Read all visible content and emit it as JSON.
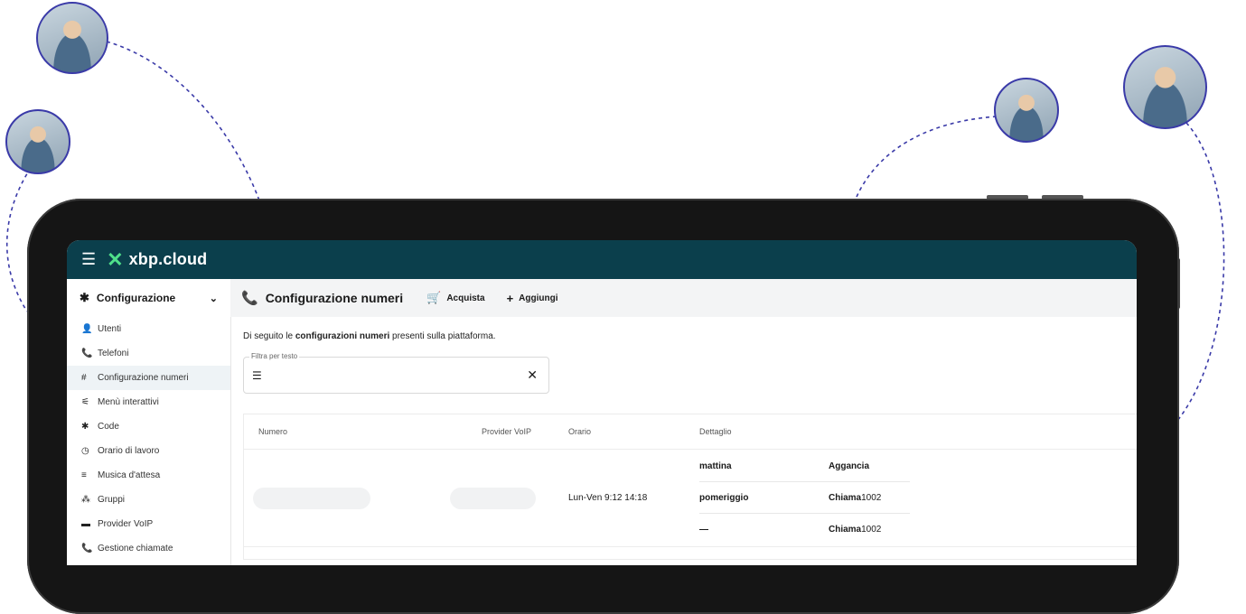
{
  "app": {
    "brand": "xbp.cloud"
  },
  "sidebar": {
    "section": "Configurazione",
    "items": [
      {
        "label": "Utenti",
        "icon": "person-icon",
        "glyph": "👤",
        "active": false
      },
      {
        "label": "Telefoni",
        "icon": "phone-icon",
        "glyph": "📞",
        "active": false
      },
      {
        "label": "Configurazione numeri",
        "icon": "hash-icon",
        "glyph": "#",
        "active": true
      },
      {
        "label": "Menù interattivi",
        "icon": "tree-icon",
        "glyph": "⚟",
        "active": false
      },
      {
        "label": "Code",
        "icon": "gear-icon",
        "glyph": "✱",
        "active": false
      },
      {
        "label": "Orario di lavoro",
        "icon": "clock-icon",
        "glyph": "◷",
        "active": false
      },
      {
        "label": "Musica d'attesa",
        "icon": "playlist-icon",
        "glyph": "≡",
        "active": false
      },
      {
        "label": "Gruppi",
        "icon": "group-icon",
        "glyph": "⁂",
        "active": false
      },
      {
        "label": "Provider VoIP",
        "icon": "card-icon",
        "glyph": "▬",
        "active": false
      },
      {
        "label": "Gestione chiamate",
        "icon": "phone-icon",
        "glyph": "📞",
        "active": false
      }
    ]
  },
  "toolbar": {
    "title": "Configurazione numeri",
    "buy_label": "Acquista",
    "add_label": "Aggiungi"
  },
  "intro": {
    "before": "Di seguito le ",
    "bold": "configurazioni numeri",
    "after": " presenti sulla piattaforma."
  },
  "filter": {
    "label": "Filtra per testo",
    "value": ""
  },
  "table": {
    "headers": {
      "numero": "Numero",
      "provider": "Provider VoIP",
      "orario": "Orario",
      "dettaglio": "Dettaglio"
    },
    "rows": [
      {
        "orario": "Lun-Ven 9:12 14:18",
        "details": [
          {
            "slot": "mattina",
            "action": "Aggancia",
            "target": ""
          },
          {
            "slot": "pomeriggio",
            "action": "Chiama",
            "target": " 1002"
          },
          {
            "slot": "—",
            "action": "Chiama",
            "target": " 1002"
          }
        ]
      }
    ]
  },
  "colors": {
    "topbar": "#0b3f4c",
    "accent": "#4fe08a",
    "ring": "#3a3aa8"
  }
}
